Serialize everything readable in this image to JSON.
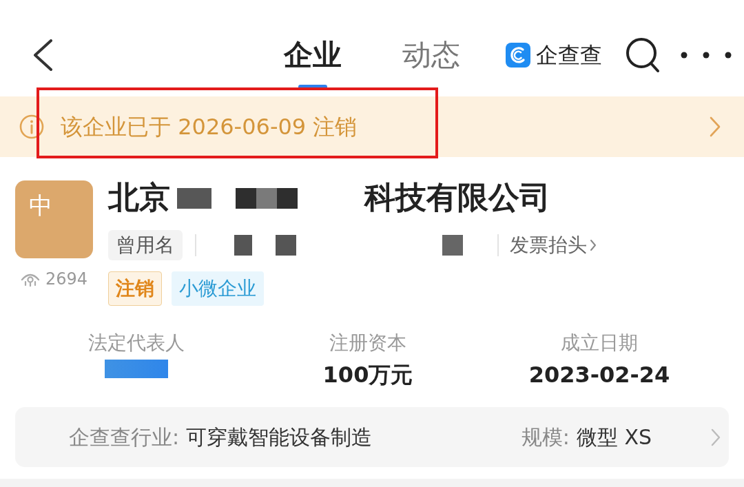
{
  "top_bar": {
    "tabs": [
      {
        "label": "企业",
        "selected": true
      },
      {
        "label": "动态",
        "selected": false
      }
    ],
    "brand": "企查查"
  },
  "notice": {
    "text": "该企业已于 2026-06-09 注销",
    "highlighted": true
  },
  "company": {
    "logo_text": "中",
    "name_start": "北京",
    "name_end": "科技有限公司",
    "former_name_label": "曾用名",
    "invoice_link": "发票抬头",
    "views": "2694",
    "tags": [
      {
        "label": "注销",
        "kind": "status"
      },
      {
        "label": "小微企业",
        "kind": "scale"
      }
    ]
  },
  "facts": [
    {
      "label": "法定代表人",
      "kind": "redacted"
    },
    {
      "label": "注册资本",
      "kind": "text",
      "value": "100万元"
    },
    {
      "label": "成立日期",
      "kind": "text",
      "value": "2023-02-24"
    }
  ],
  "industry": {
    "label": "企查查行业:",
    "value": "可穿戴智能设备制造",
    "scale_label": "规模:",
    "scale_value": "微型 XS"
  }
}
